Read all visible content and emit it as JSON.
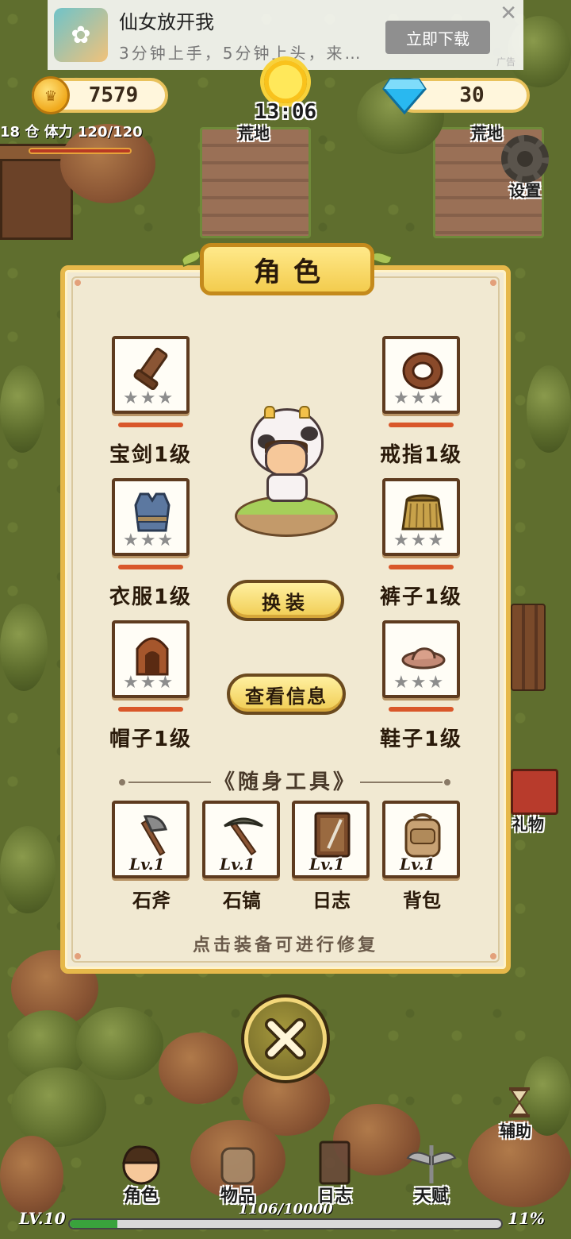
{
  "ad": {
    "title": "仙女放开我",
    "subtitle": "3分钟上手，5分钟上头，来…",
    "button": "立即下载",
    "close": "✕",
    "mark": "广告"
  },
  "hud": {
    "coins": "7579",
    "gems": "30",
    "time": "13:06",
    "plot_left_label": "荒地",
    "plot_right_label": "荒地",
    "stamina_prefix": "18 仓",
    "stamina_label": "体力",
    "stamina_value": "120/120",
    "settings_label": "设置"
  },
  "panel": {
    "title": "角色",
    "equipment_left": [
      {
        "label": "宝剑1级",
        "icon": "sword-icon",
        "stars": 3
      },
      {
        "label": "衣服1级",
        "icon": "vest-icon",
        "stars": 3
      },
      {
        "label": "帽子1级",
        "icon": "hat-icon",
        "stars": 3
      }
    ],
    "equipment_right": [
      {
        "label": "戒指1级",
        "icon": "ring-icon",
        "stars": 3
      },
      {
        "label": "裤子1级",
        "icon": "skirt-icon",
        "stars": 3
      },
      {
        "label": "鞋子1级",
        "icon": "shoes-icon",
        "stars": 3
      }
    ],
    "change_outfit_button": "换装",
    "view_info_button": "查看信息",
    "tools_title": "随身工具",
    "tools_left_deco": "《",
    "tools_right_deco": "》",
    "tools": [
      {
        "label": "石斧",
        "level": "Lv.1",
        "icon": "axe-icon"
      },
      {
        "label": "石镐",
        "level": "Lv.1",
        "icon": "pickaxe-icon"
      },
      {
        "label": "日志",
        "level": "Lv.1",
        "icon": "journal-icon"
      },
      {
        "label": "背包",
        "level": "Lv.1",
        "icon": "backpack-icon"
      }
    ],
    "hint": "点击装备可进行修复"
  },
  "side": {
    "gift_label": "礼物",
    "assist_label": "辅助"
  },
  "nav": [
    {
      "label": "角色",
      "icon": "character-icon"
    },
    {
      "label": "物品",
      "icon": "bag-icon"
    },
    {
      "label": "日志",
      "icon": "book-icon"
    },
    {
      "label": "天赋",
      "icon": "talent-wings-icon"
    }
  ],
  "xp": {
    "level": "LV.10",
    "progress_text": "1106/10000",
    "percent_text": "11%",
    "fraction": 0.11
  },
  "colors": {
    "panel_bg": "#f1e9d2",
    "panel_border": "#e6b84a",
    "button_gold": "#f0cc52",
    "durability_red": "#d9572a",
    "xp_green": "#39a33c"
  }
}
